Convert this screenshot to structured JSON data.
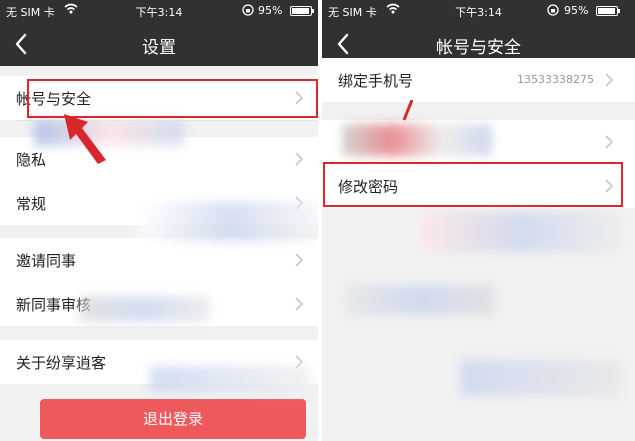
{
  "status_bar": {
    "carrier": "无 SIM 卡",
    "time": "下午3:14",
    "battery_pct": "95%",
    "battery_level": 0.95
  },
  "left": {
    "nav": {
      "back_icon": "back-chevron-icon",
      "title": "设置"
    },
    "items": [
      {
        "label": "帐号与安全"
      },
      {
        "label": "隐私"
      },
      {
        "label": "常规"
      },
      {
        "label": "邀请同事"
      },
      {
        "label": "新同事审核"
      },
      {
        "label": "关于纷享逍客"
      }
    ],
    "logout_label": "退出登录"
  },
  "right": {
    "nav": {
      "back_icon": "back-chevron-icon",
      "title": "帐号与安全"
    },
    "items": [
      {
        "label": "绑定手机号",
        "value": "13533338275"
      },
      {
        "label": ""
      },
      {
        "label": "修改密码"
      }
    ]
  },
  "colors": {
    "nav_bg": "#2f3133",
    "highlight": "#e0262a",
    "logout_bg": "#f0595c",
    "arrow": "#d8272b"
  }
}
